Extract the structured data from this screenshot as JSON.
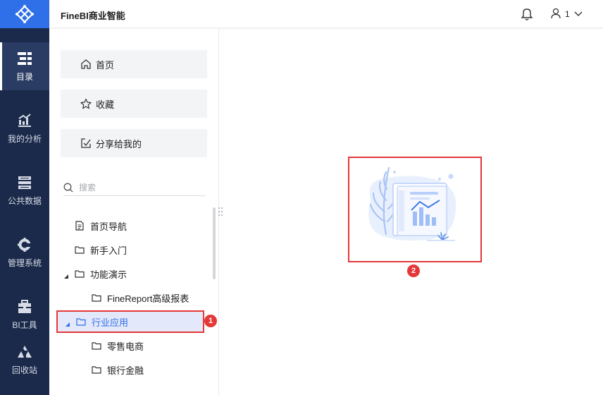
{
  "app": {
    "title": "FineBI商业智能"
  },
  "header": {
    "user_name": "1",
    "notification_icon": "bell-icon",
    "user_icon": "user-icon"
  },
  "left_nav": {
    "items": [
      {
        "label": "目录",
        "icon": "catalog-icon",
        "active": true
      },
      {
        "label": "我的分析",
        "icon": "analysis-chart-icon",
        "active": false
      },
      {
        "label": "公共数据",
        "icon": "database-icon",
        "active": false
      },
      {
        "label": "管理系统",
        "icon": "gear-icon",
        "active": false
      },
      {
        "label": "BI工具",
        "icon": "toolbox-icon",
        "active": false
      },
      {
        "label": "回收站",
        "icon": "recycle-bin-icon",
        "active": false
      }
    ]
  },
  "quick_links": [
    {
      "label": "首页",
      "icon": "home-icon"
    },
    {
      "label": "收藏",
      "icon": "star-icon"
    },
    {
      "label": "分享给我的",
      "icon": "share-icon"
    }
  ],
  "search": {
    "placeholder": "搜索"
  },
  "tree": [
    {
      "label": "首页导航",
      "icon": "document-icon"
    },
    {
      "label": "新手入门",
      "icon": "folder-icon"
    },
    {
      "label": "功能演示",
      "icon": "folder-icon",
      "expanded": true
    },
    {
      "label": "FineReport高级报表",
      "icon": "folder-icon"
    },
    {
      "label": "行业应用",
      "icon": "folder-icon",
      "expanded": true,
      "selected": true
    },
    {
      "label": "零售电商",
      "icon": "folder-icon"
    },
    {
      "label": "银行金融",
      "icon": "folder-icon"
    }
  ],
  "annotations": {
    "badge_1": "1",
    "badge_2": "2"
  },
  "colors": {
    "brand": "#2f6fe8",
    "nav_bg": "#1b2a4a",
    "highlight": "#e43838",
    "selected_bg": "#e3e8fb"
  }
}
